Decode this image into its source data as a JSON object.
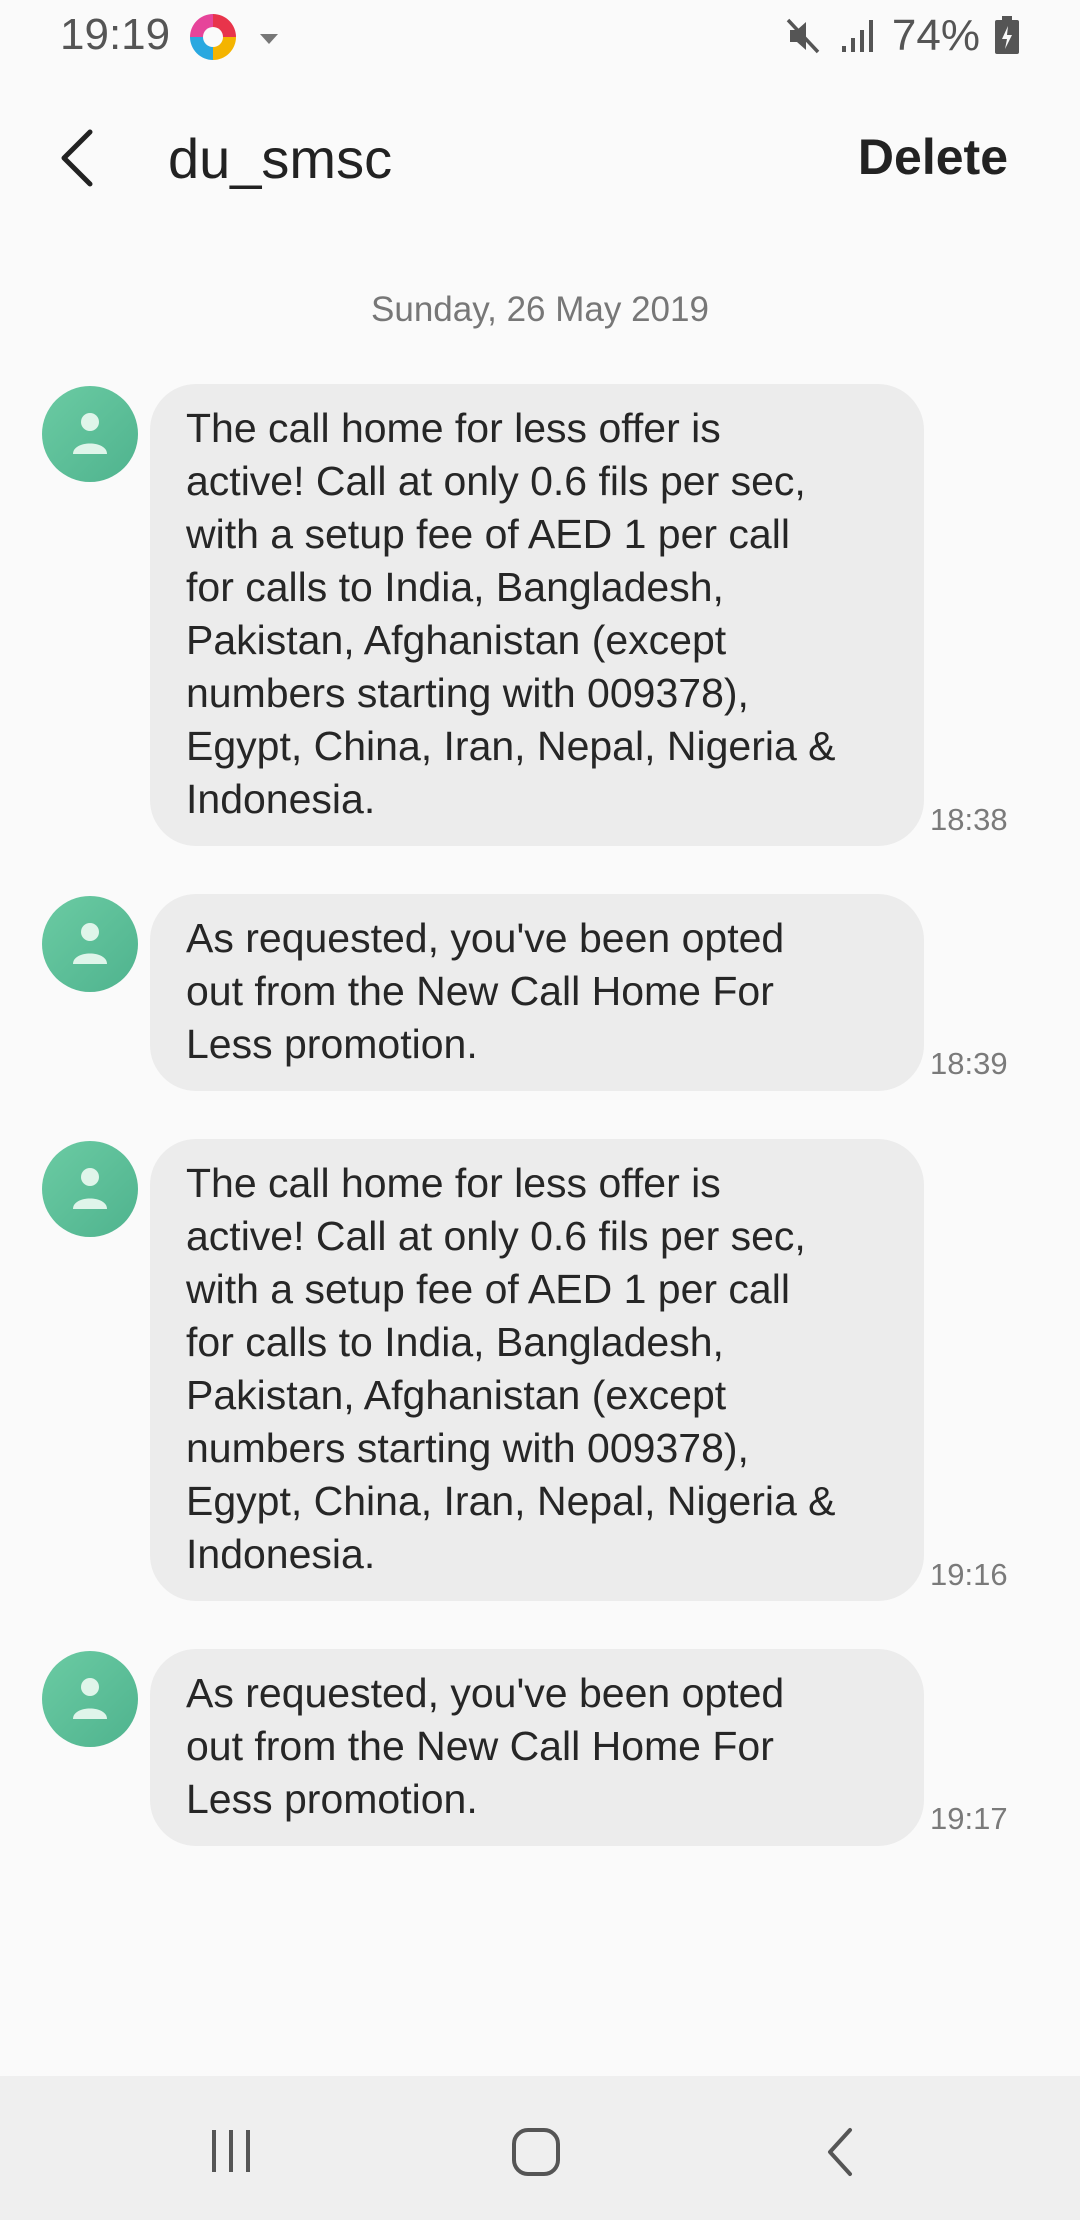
{
  "status_bar": {
    "time": "19:19",
    "battery": "74%",
    "icons": [
      "app-notification-icon",
      "dropdown-icon",
      "mute-icon",
      "signal-icon",
      "battery-icon"
    ]
  },
  "header": {
    "contact": "du_smsc",
    "delete_label": "Delete",
    "back_icon": "back-arrow-icon"
  },
  "conversation": {
    "date": "Sunday, 26 May 2019",
    "messages": [
      {
        "lines": [
          "The call home for less offer is",
          "active! Call at only 0.6 fils per sec,",
          "with a setup fee of AED 1 per call",
          "for calls to India, Bangladesh,",
          "Pakistan, Afghanistan (except",
          "numbers starting with 009378),",
          "Egypt, China, Iran, Nepal, Nigeria &",
          "Indonesia."
        ],
        "time": "18:38"
      },
      {
        "lines": [
          "As requested, you've been opted",
          "out from the New Call Home For",
          "Less promotion."
        ],
        "time": "18:39"
      },
      {
        "lines": [
          "The call home for less offer is",
          "active! Call at only 0.6 fils per sec,",
          "with a setup fee of AED 1 per call",
          "for calls to India, Bangladesh,",
          "Pakistan, Afghanistan (except",
          "numbers starting with 009378),",
          "Egypt, China, Iran, Nepal, Nigeria &",
          "Indonesia."
        ],
        "time": "19:16"
      },
      {
        "lines": [
          "As requested, you've been opted",
          "out from the New Call Home For",
          "Less promotion."
        ],
        "time": "19:17"
      }
    ]
  },
  "nav_bar": {
    "icons": [
      "recent-apps-icon",
      "home-icon",
      "back-icon"
    ]
  },
  "colors": {
    "background": "#fafafa",
    "bubble": "#ececec",
    "avatar": "#5cbf99",
    "nav_bar": "#efefef"
  }
}
